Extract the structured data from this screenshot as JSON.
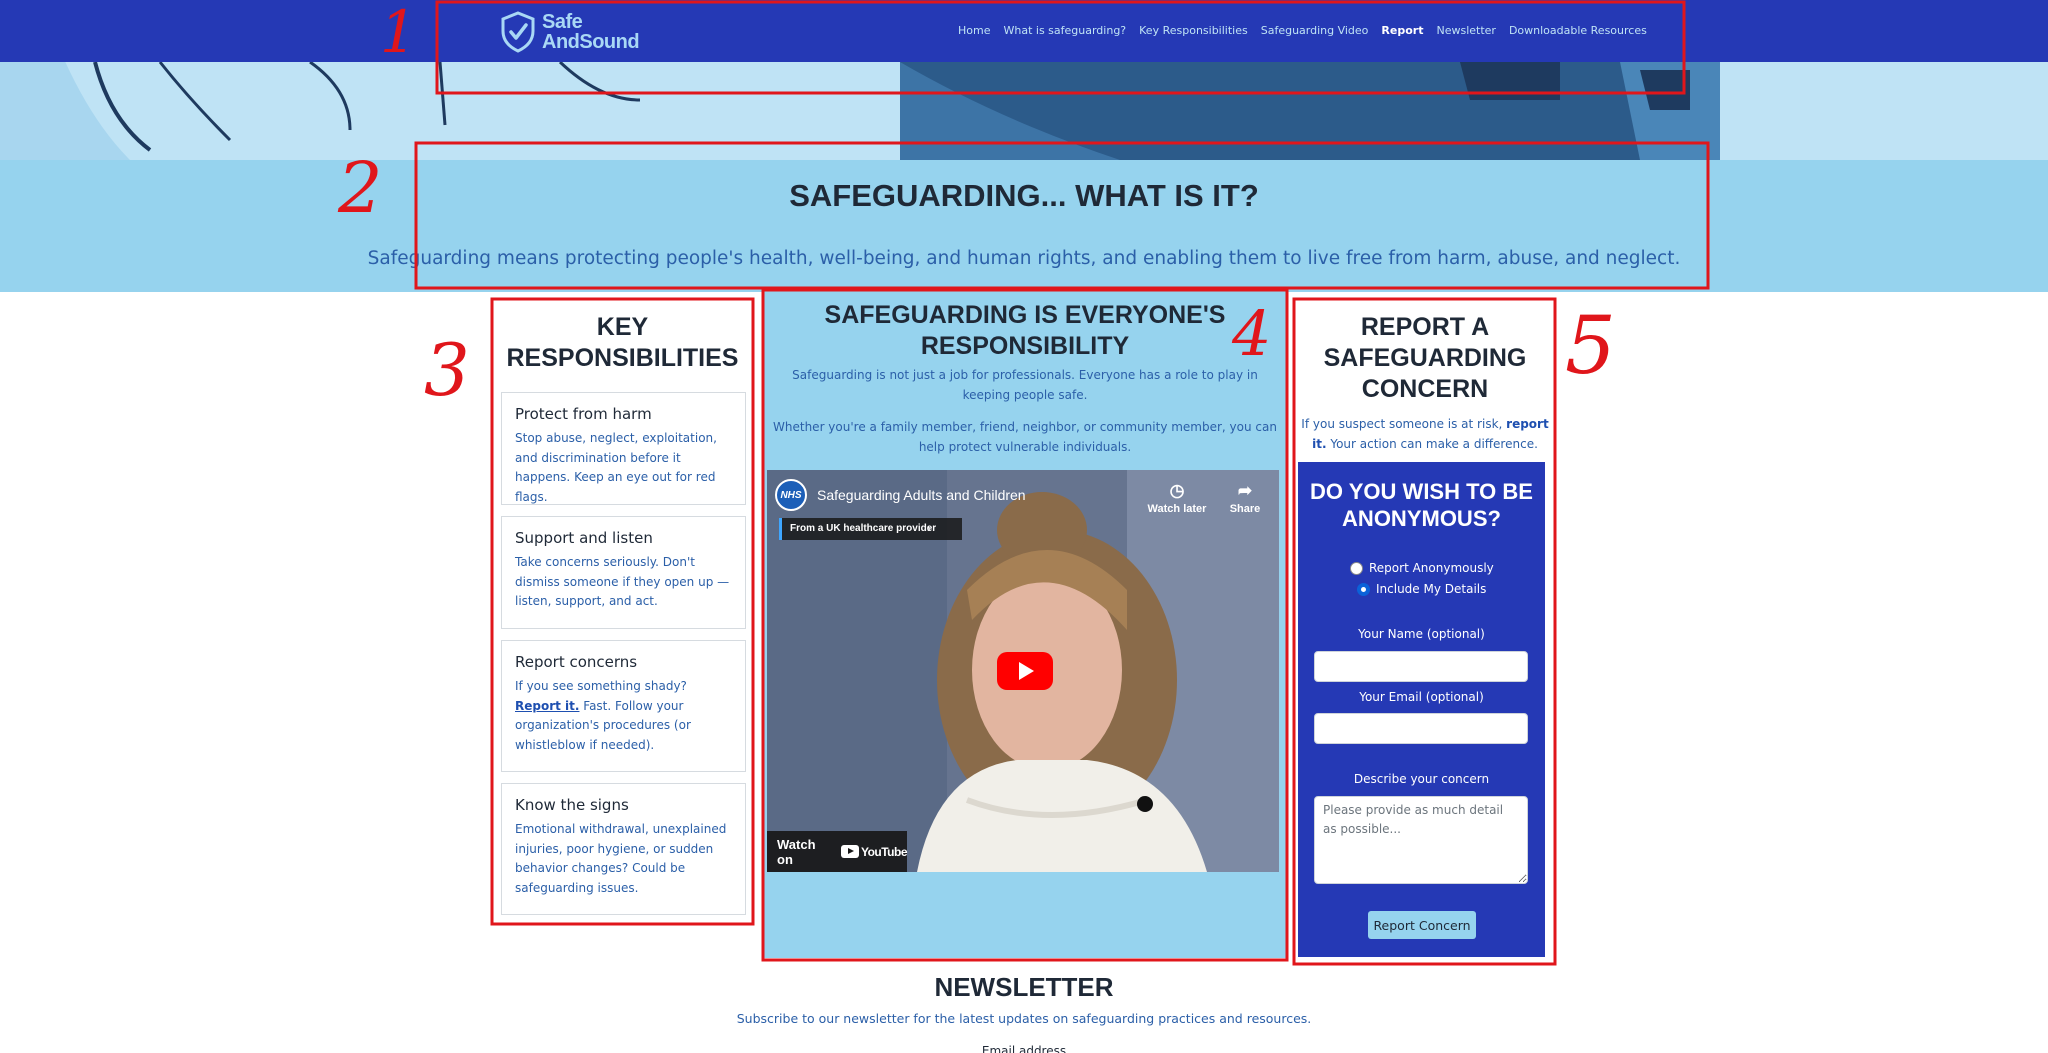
{
  "brand": {
    "line1": "Safe",
    "line2": "AndSound"
  },
  "nav": {
    "links": [
      {
        "label": "Home",
        "active": false
      },
      {
        "label": "What is safeguarding?",
        "active": false
      },
      {
        "label": "Key Responsibilities",
        "active": false
      },
      {
        "label": "Safeguarding Video",
        "active": false
      },
      {
        "label": "Report",
        "active": true
      },
      {
        "label": "Newsletter",
        "active": false
      },
      {
        "label": "Downloadable Resources",
        "active": false
      }
    ]
  },
  "intro": {
    "title": "SAFEGUARDING... WHAT IS IT?",
    "text": "Safeguarding means protecting people's health, well-being, and human rights, and enabling them to live free from harm, abuse, and neglect."
  },
  "responsibilities": {
    "title": "KEY RESPONSIBILITIES",
    "cards": [
      {
        "title": "Protect from harm",
        "text": "Stop abuse, neglect, exploitation, and discrimination before it happens. Keep an eye out for red flags."
      },
      {
        "title": "Support and listen",
        "text": "Take concerns seriously. Don't dismiss someone if they open up — listen, support, and act."
      },
      {
        "title": "Report concerns",
        "text_before": "If you see something shady? ",
        "link": "Report it.",
        "text_after": " Fast. Follow your organization's procedures (or whistleblow if needed)."
      },
      {
        "title": "Know the signs",
        "text": "Emotional withdrawal, unexplained injuries, poor hygiene, or sudden behavior changes? Could be safeguarding issues."
      }
    ]
  },
  "everyone": {
    "title": "SAFEGUARDING IS EVERYONE'S RESPONSIBILITY",
    "p1": "Safeguarding is not just a job for professionals. Everyone has a role to play in keeping people safe.",
    "p2": "Whether you're a family member, friend, neighbor, or community member, you can help protect vulnerable individuals.",
    "video": {
      "channel_badge": "NHS",
      "title": "Safeguarding Adults and Children",
      "provider": "From a UK healthcare provider",
      "watch_later": "Watch later",
      "share": "Share",
      "watch_on": "Watch on",
      "youtube": "YouTube"
    }
  },
  "report": {
    "title": "REPORT A SAFEGUARDING CONCERN",
    "intro_before": "If you suspect someone is at risk, ",
    "intro_link": "report it.",
    "intro_after": " Your action can make a difference.",
    "form": {
      "anon_title": "DO YOU WISH TO BE ANONYMOUS?",
      "option_anon": "Report Anonymously",
      "option_details": "Include My Details",
      "selected": "Include My Details",
      "name_label": "Your Name (optional)",
      "name_value": "",
      "email_label": "Your Email (optional)",
      "email_value": "",
      "concern_label": "Describe your concern",
      "concern_placeholder": "Please provide as much detail as possible...",
      "submit": "Report Concern"
    }
  },
  "newsletter": {
    "title": "NEWSLETTER",
    "text": "Subscribe to our newsletter for the latest updates on safeguarding practices and resources.",
    "email_label": "Email address"
  },
  "annotations": {
    "labels": [
      "1",
      "2",
      "3",
      "4",
      "5"
    ],
    "color": "#e0161b"
  },
  "colors": {
    "nav": "#2539b5",
    "light_blue": "#96d3ee",
    "text_blue": "#2b5fa8",
    "form_blue": "#2539b5"
  }
}
